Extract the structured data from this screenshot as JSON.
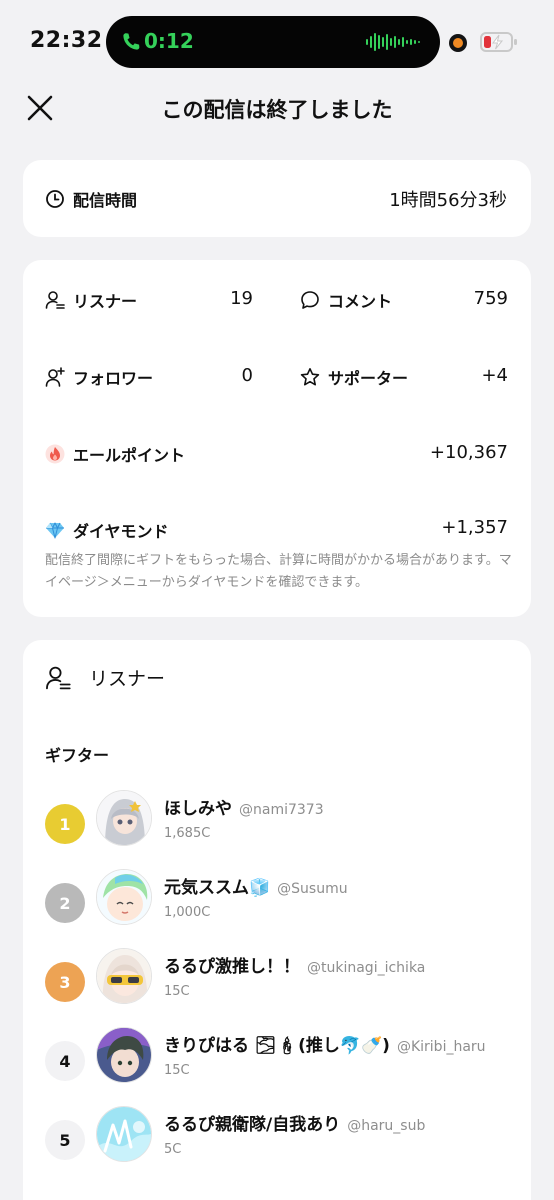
{
  "status_bar": {
    "time": "22:32",
    "call_time": "0:12",
    "call_color": "#35d15a",
    "camera_dot_color": "#f08a23",
    "battery_color": "#e2333b"
  },
  "header": {
    "title": "この配信は終了しました",
    "close_icon": "close-icon"
  },
  "duration": {
    "label": "配信時間",
    "value": "1時間56分3秒",
    "icon": "clock-icon"
  },
  "stats": {
    "listeners": {
      "label": "リスナー",
      "value": "19",
      "icon": "user-list-icon"
    },
    "comments": {
      "label": "コメント",
      "value": "759",
      "icon": "speech-bubble-icon"
    },
    "followers": {
      "label": "フォロワー",
      "value": "0",
      "icon": "user-plus-icon"
    },
    "supporters": {
      "label": "サポーター",
      "value": "+4",
      "icon": "star-icon"
    },
    "yell_points": {
      "label": "エールポイント",
      "value": "+10,367",
      "icon": "flame-icon"
    },
    "diamonds": {
      "label": "ダイヤモンド",
      "value": "+1,357",
      "icon": "diamond-icon"
    },
    "note": "配信終了間際にギフトをもらった場合、計算に時間がかかる場合があります。マイページ＞メニューからダイヤモンドを確認できます。"
  },
  "listener_section": {
    "title": "リスナー",
    "gifter_heading": "ギフター",
    "gifters": [
      {
        "rank": "1",
        "name": "ほしみや",
        "handle": "@nami7373",
        "coins": "1,685C"
      },
      {
        "rank": "2",
        "name": "元気ススム🧊",
        "handle": "@Susumu",
        "coins": "1,000C"
      },
      {
        "rank": "3",
        "name": "るるぴ激推し！！",
        "handle": "@tukinagi_ichika",
        "coins": "15C"
      },
      {
        "rank": "4",
        "name": "きりぴはる 🌫🕯(推し🐬🍼)",
        "handle": "@Kiribi_haru",
        "coins": "15C"
      },
      {
        "rank": "5",
        "name": "るるぴ親衛隊/自我あり",
        "handle": "@haru_sub",
        "coins": "5C"
      }
    ]
  }
}
